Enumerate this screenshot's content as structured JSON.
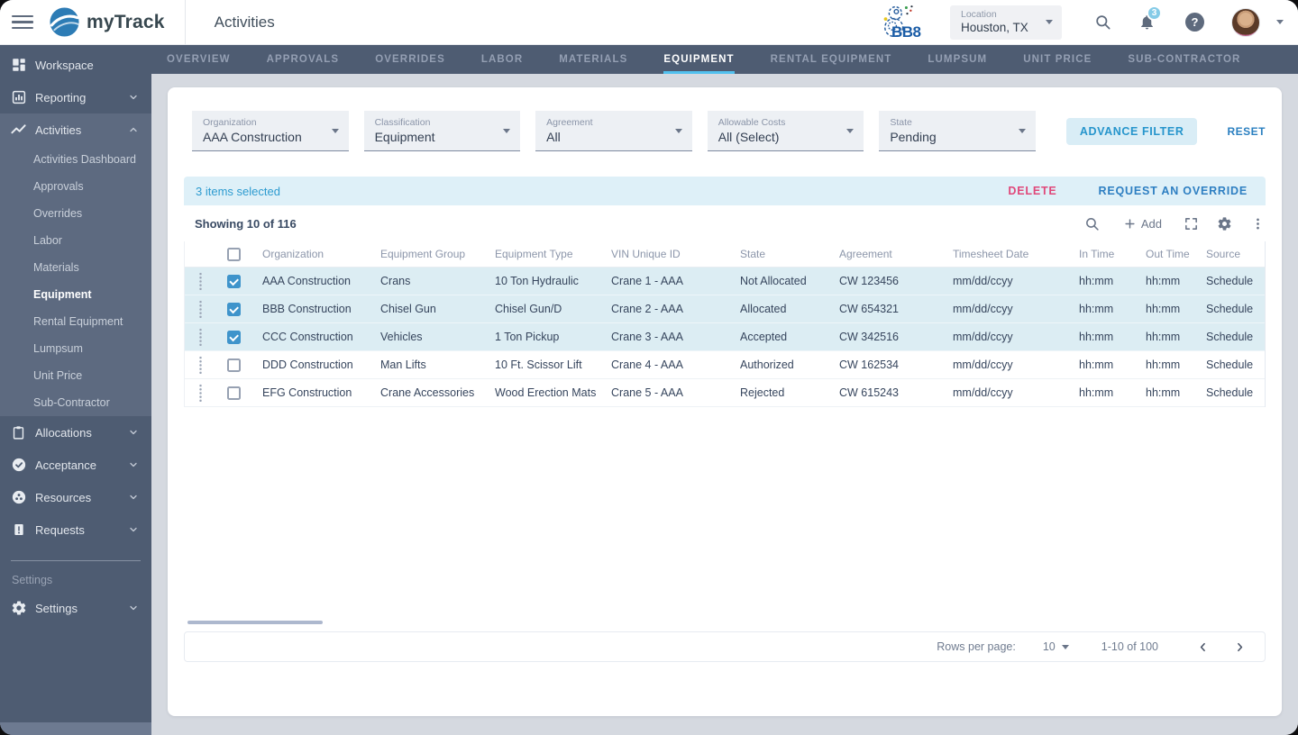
{
  "colors": {
    "accent_blue": "#2d9bd0",
    "tab_underline": "#52c1ef",
    "delete_red": "#e0487a",
    "override_blue": "#2e7fc2",
    "sidebar_bg": "#4e5c72",
    "sidebar_expanded_bg": "#5d6a80",
    "selection_bar_bg": "#def0f8",
    "selected_row_bg": "#dcedf3",
    "checkbox_blue": "#3f94cb",
    "badge_blue": "#85cbe7"
  },
  "header": {
    "app_name": "myTrack",
    "page_title": "Activities",
    "brand_secondary": "BB8",
    "location": {
      "label": "Location",
      "value": "Houston, TX"
    },
    "notifications_badge": "3"
  },
  "sidebar": {
    "items": [
      {
        "label": "Workspace",
        "icon": "workspace-grid",
        "chevron": null
      },
      {
        "label": "Reporting",
        "icon": "report-chart",
        "chevron": "down"
      },
      {
        "label": "Activities",
        "icon": "activities-trend",
        "chevron": "up",
        "expanded": true,
        "active_child": "Equipment",
        "children": [
          "Activities Dashboard",
          "Approvals",
          "Overrides",
          "Labor",
          "Materials",
          "Equipment",
          "Rental Equipment",
          "Lumpsum",
          "Unit Price",
          "Sub-Contractor"
        ]
      },
      {
        "label": "Allocations",
        "icon": "clipboard",
        "chevron": "down"
      },
      {
        "label": "Acceptance",
        "icon": "check-circle",
        "chevron": "down"
      },
      {
        "label": "Resources",
        "icon": "resources",
        "chevron": "down"
      },
      {
        "label": "Requests",
        "icon": "request-file",
        "chevron": "down"
      }
    ],
    "section_label": "Settings",
    "settings_item": {
      "label": "Settings",
      "icon": "gear",
      "chevron": "down"
    }
  },
  "tabs": {
    "active": "EQUIPMENT",
    "items": [
      "OVERVIEW",
      "APPROVALS",
      "OVERRIDES",
      "LABOR",
      "MATERIALS",
      "EQUIPMENT",
      "RENTAL EQUIPMENT",
      "LUMPSUM",
      "UNIT PRICE",
      "SUB-CONTRACTOR"
    ]
  },
  "filters": {
    "fields": [
      {
        "label": "Organization",
        "value": "AAA Construction"
      },
      {
        "label": "Classification",
        "value": "Equipment"
      },
      {
        "label": "Agreement",
        "value": "All"
      },
      {
        "label": "Allowable Costs",
        "value": "All (Select)"
      },
      {
        "label": "State",
        "value": "Pending"
      }
    ],
    "advance_button": "ADVANCE FILTER",
    "reset_button": "RESET"
  },
  "selection_bar": {
    "text": "3 items selected",
    "delete_label": "DELETE",
    "override_label": "REQUEST AN OVERRIDE"
  },
  "table": {
    "summary": "Showing 10 of 116",
    "add_label": "Add",
    "columns": [
      "Organization",
      "Equipment Group",
      "Equipment Type",
      "VIN Unique ID",
      "State",
      "Agreement",
      "Timesheet Date",
      "In Time",
      "Out Time",
      "Source"
    ],
    "rows": [
      {
        "selected": true,
        "cells": [
          "AAA Construction",
          "Crans",
          "10 Ton Hydraulic",
          "Crane 1 - AAA",
          "Not Allocated",
          "CW 123456",
          "mm/dd/ccyy",
          "hh:mm",
          "hh:mm",
          "Schedule"
        ]
      },
      {
        "selected": true,
        "cells": [
          "BBB Construction",
          "Chisel Gun",
          "Chisel Gun/D",
          "Crane 2 - AAA",
          "Allocated",
          "CW 654321",
          "mm/dd/ccyy",
          "hh:mm",
          "hh:mm",
          "Schedule"
        ]
      },
      {
        "selected": true,
        "cells": [
          "CCC Construction",
          "Vehicles",
          "1 Ton Pickup",
          "Crane 3 - AAA",
          "Accepted",
          "CW 342516",
          "mm/dd/ccyy",
          "hh:mm",
          "hh:mm",
          "Schedule"
        ]
      },
      {
        "selected": false,
        "cells": [
          "DDD Construction",
          "Man Lifts",
          "10 Ft. Scissor Lift",
          "Crane 4 - AAA",
          "Authorized",
          "CW 162534",
          "mm/dd/ccyy",
          "hh:mm",
          "hh:mm",
          "Schedule"
        ]
      },
      {
        "selected": false,
        "cells": [
          "EFG Construction",
          "Crane Accessories",
          "Wood Erection Mats",
          "Crane 5 - AAA",
          "Rejected",
          "CW 615243",
          "mm/dd/ccyy",
          "hh:mm",
          "hh:mm",
          "Schedule"
        ]
      }
    ]
  },
  "pagination": {
    "rows_per_page_label": "Rows per page:",
    "rows_per_page_value": "10",
    "range_text": "1-10 of 100"
  }
}
